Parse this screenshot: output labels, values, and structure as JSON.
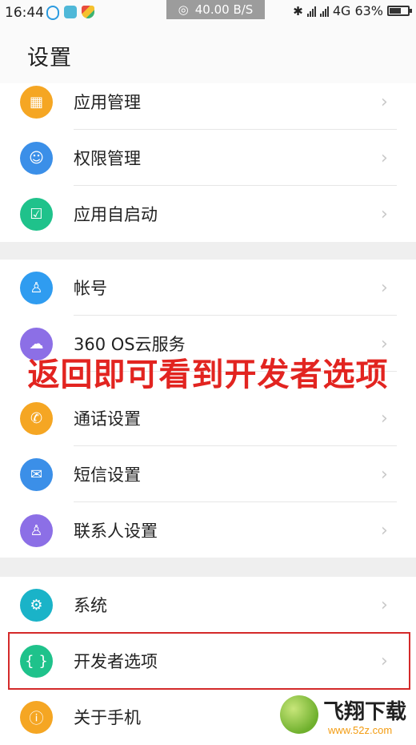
{
  "status_bar": {
    "time": "16:44",
    "net_speed": "40.00 B/S",
    "network": "4G",
    "battery": "63%",
    "battery_level": 0.63
  },
  "header": {
    "title": "设置"
  },
  "sections": [
    {
      "items": [
        {
          "label": "应用管理",
          "icon": "grid-icon",
          "color": "#f5a623"
        },
        {
          "label": "权限管理",
          "icon": "android-icon",
          "color": "#3b8fe8"
        },
        {
          "label": "应用自启动",
          "icon": "checkbox-icon",
          "color": "#1fc28b"
        }
      ]
    },
    {
      "items": [
        {
          "label": "帐号",
          "icon": "person-icon",
          "color": "#2f9cf0"
        },
        {
          "label": "360 OS云服务",
          "icon": "cloud-icon",
          "color": "#8c6fe6"
        },
        {
          "label": "通话设置",
          "icon": "phone-icon",
          "color": "#f5a623"
        },
        {
          "label": "短信设置",
          "icon": "message-icon",
          "color": "#3b8fe8"
        },
        {
          "label": "联系人设置",
          "icon": "contact-icon",
          "color": "#8c6fe6"
        }
      ]
    },
    {
      "items": [
        {
          "label": "系统",
          "icon": "gear-icon",
          "color": "#1ab3c8"
        },
        {
          "label": "开发者选项",
          "icon": "braces-icon",
          "color": "#1fc28b"
        },
        {
          "label": "关于手机",
          "icon": "info-icon",
          "color": "#f5a623"
        }
      ]
    }
  ],
  "overlay_caption": "返回即可看到开发者选项",
  "watermark": {
    "brand": "飞翔下载",
    "url": "www.52z.com"
  }
}
